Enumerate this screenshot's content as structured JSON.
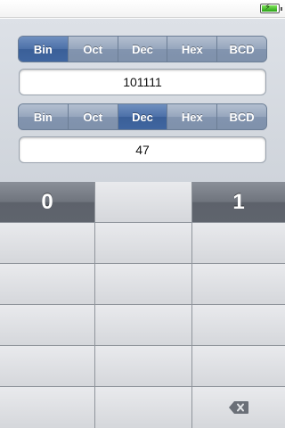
{
  "status_bar": {
    "battery_icon": "battery-charging-icon"
  },
  "input_base": {
    "options": [
      "Bin",
      "Oct",
      "Dec",
      "Hex",
      "BCD"
    ],
    "selected": "Bin"
  },
  "input_value": "101111",
  "output_base": {
    "options": [
      "Bin",
      "Oct",
      "Dec",
      "Hex",
      "BCD"
    ],
    "selected": "Dec"
  },
  "output_value": "47",
  "keypad": {
    "key_0": "0",
    "key_1": "1",
    "backspace_icon": "backspace-icon"
  },
  "colors": {
    "segment_selected": "#4c70a8",
    "segment_default": "#8c9cb4",
    "key_dark": "#6f747d",
    "key_light": "#dfe0e3"
  }
}
